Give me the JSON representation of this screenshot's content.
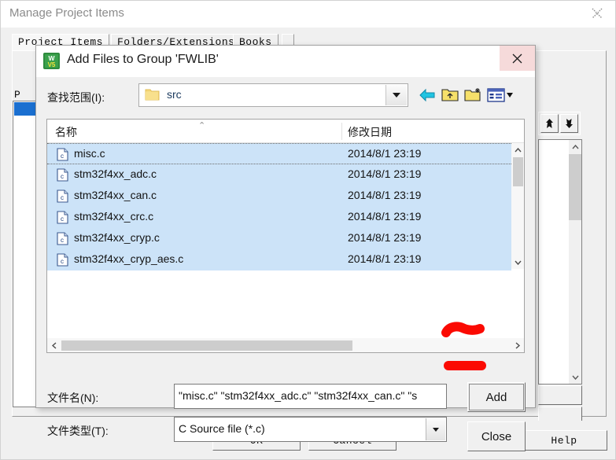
{
  "background_window": {
    "title": "Manage Project Items",
    "close_icon": "close-icon",
    "tabs": [
      {
        "label": "Project Items",
        "active": true
      },
      {
        "label": "Folders/Extensions",
        "active": false
      },
      {
        "label": "Books",
        "active": false
      },
      {
        "label": "",
        "active": false
      }
    ],
    "group_label": "P",
    "arrow_buttons": {
      "up_icon": "arrow-up-icon",
      "down_icon": "arrow-down-icon"
    },
    "buttons": {
      "ok": "OK",
      "cancel": "Cancel",
      "help": "Help"
    }
  },
  "dialog": {
    "title": "Add Files to Group 'FWLIB'",
    "icon": "uvision-app-icon",
    "close_icon": "close-icon",
    "lookin": {
      "label": "查找范围(I):",
      "value": "src",
      "folder_icon": "folder-icon",
      "dropdown_icon": "chevron-down-icon"
    },
    "toolbar": [
      {
        "name": "back-icon",
        "title": "back"
      },
      {
        "name": "up-folder-icon",
        "title": "up one level"
      },
      {
        "name": "new-folder-icon",
        "title": "create new folder"
      },
      {
        "name": "views-icon",
        "title": "views"
      }
    ],
    "file_list": {
      "columns": [
        "名称",
        "修改日期"
      ],
      "sort_caret": "⌃",
      "rows": [
        {
          "icon": "c-file-icon",
          "name": "misc.c",
          "date": "2014/8/1 23:19",
          "selected": true,
          "focused": true
        },
        {
          "icon": "c-file-icon",
          "name": "stm32f4xx_adc.c",
          "date": "2014/8/1 23:19",
          "selected": true,
          "focused": false
        },
        {
          "icon": "c-file-icon",
          "name": "stm32f4xx_can.c",
          "date": "2014/8/1 23:19",
          "selected": true,
          "focused": false
        },
        {
          "icon": "c-file-icon",
          "name": "stm32f4xx_crc.c",
          "date": "2014/8/1 23:19",
          "selected": true,
          "focused": false
        },
        {
          "icon": "c-file-icon",
          "name": "stm32f4xx_cryp.c",
          "date": "2014/8/1 23:19",
          "selected": true,
          "focused": false
        },
        {
          "icon": "c-file-icon",
          "name": "stm32f4xx_cryp_aes.c",
          "date": "2014/8/1 23:19",
          "selected": true,
          "focused": false
        }
      ],
      "vertical_scrollbar": {
        "up_icon": "chevron-up-icon",
        "down_icon": "chevron-down-icon"
      },
      "horizontal_scrollbar": {
        "left_icon": "chevron-left-icon",
        "right_icon": "chevron-right-icon"
      }
    },
    "filename": {
      "label": "文件名(N):",
      "value": "\"misc.c\" \"stm32f4xx_adc.c\" \"stm32f4xx_can.c\" \"s"
    },
    "filetype": {
      "label": "文件类型(T):",
      "value": "C Source file (*.c)",
      "dropdown_icon": "chevron-down-icon"
    },
    "buttons": {
      "add": "Add",
      "close": "Close"
    }
  },
  "annotations": {
    "marker_color": "#fb0a02",
    "marks": [
      "add-button-highlight",
      "close-button-highlight"
    ]
  }
}
